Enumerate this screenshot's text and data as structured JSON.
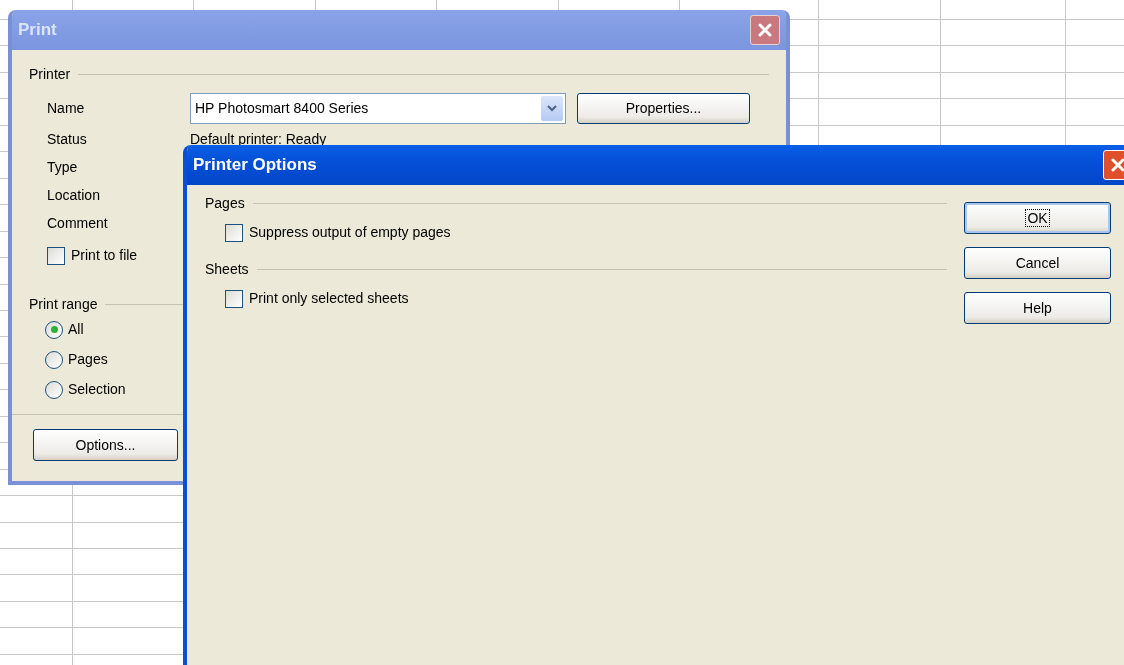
{
  "print_dialog": {
    "title": "Print",
    "active": false,
    "printer": {
      "heading": "Printer",
      "name_label": "Name",
      "name_value": "HP Photosmart 8400 Series",
      "properties_button": "Properties...",
      "info_rows": [
        {
          "label": "Status",
          "value": "Default printer: Ready"
        },
        {
          "label": "Type"
        },
        {
          "label": "Location"
        },
        {
          "label": "Comment"
        }
      ],
      "print_to_file": {
        "label": "Print to file",
        "checked": false
      }
    },
    "print_range": {
      "heading": "Print range",
      "options": [
        {
          "label": "All",
          "selected": true
        },
        {
          "label": "Pages",
          "selected": false
        },
        {
          "label": "Selection",
          "selected": false
        }
      ]
    },
    "options_button": "Options..."
  },
  "printer_options": {
    "title": "Printer Options",
    "active": true,
    "groups": [
      {
        "heading": "Pages",
        "options": [
          {
            "label": "Suppress output of empty pages",
            "checked": false
          }
        ]
      },
      {
        "heading": "Sheets",
        "options": [
          {
            "label": "Print only selected sheets",
            "checked": false
          }
        ]
      }
    ],
    "buttons": [
      {
        "label": "OK",
        "focused": true
      },
      {
        "label": "Cancel",
        "focused": false
      },
      {
        "label": "Help",
        "focused": false
      }
    ]
  }
}
